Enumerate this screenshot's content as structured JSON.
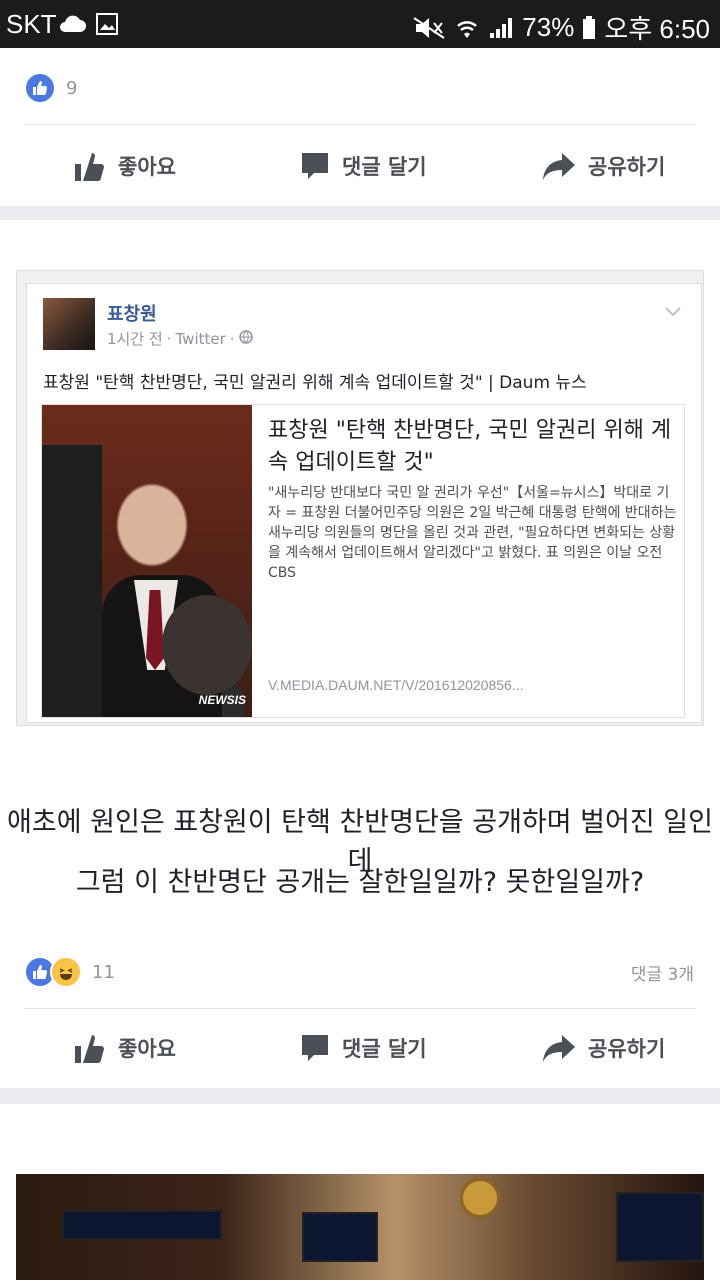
{
  "status_bar": {
    "carrier": "SKT",
    "battery": "73%",
    "time": "오후 6:50"
  },
  "post1": {
    "like_count": "9",
    "actions": {
      "like": "좋아요",
      "comment": "댓글 달기",
      "share": "공유하기"
    }
  },
  "post2": {
    "embed": {
      "author": "표창원",
      "time": "1시간 전",
      "source": "Twitter",
      "text": "표창원 \"탄핵 찬반명단, 국민 알권리 위해 계속 업데이트할 것\" | Daum 뉴스",
      "link": {
        "title": "표창원 \"탄핵 찬반명단, 국민 알권리 위해 계속 업데이트할 것\"",
        "description": "\"새누리당 반대보다 국민 알 권리가 우선\"【서울=뉴시스】박대로 기자 = 표창원 더불어민주당 의원은 2일 박근혜 대통령 탄핵에 반대하는 새누리당 의원들의 명단을 올린 것과 관련, \"필요하다면 변화되는 상황을 계속해서 업데이트해서 알리겠다\"고 밝혔다. 표 의원은 이날 오전 CBS",
        "url": "V.MEDIA.DAUM.NET/V/201612020856...",
        "image_caption": "NEWSIS"
      }
    },
    "body_lines": [
      "애초에 원인은 표창원이 탄핵 찬반명단을 공개하며 벌어진 일인데",
      "그럼 이 찬반명단 공개는 잘한일일까? 못한일일까?"
    ],
    "reaction_count": "11",
    "comment_count": "댓글 3개",
    "actions": {
      "like": "좋아요",
      "comment": "댓글 달기",
      "share": "공유하기"
    }
  },
  "colors": {
    "facebook_blue": "#4a79e4",
    "link_blue": "#365899",
    "action_gray": "#4b4f56"
  }
}
